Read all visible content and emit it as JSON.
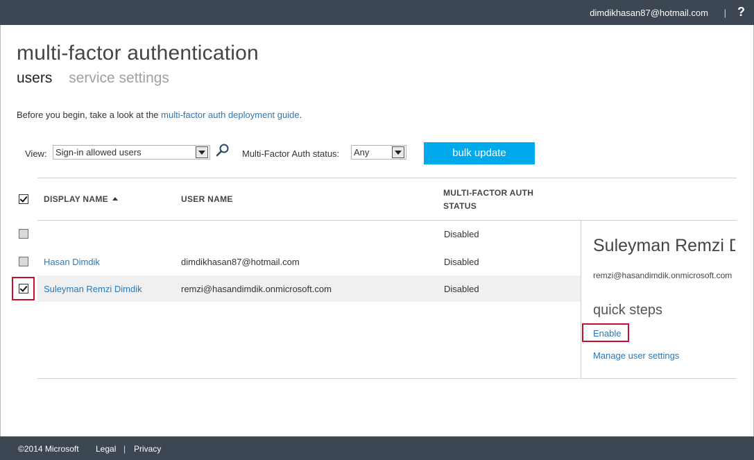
{
  "header": {
    "account": "dimdikhasan87@hotmail.com",
    "separator": "|",
    "help": "?"
  },
  "page": {
    "title": "multi-factor authentication",
    "tabs": [
      {
        "label": "users",
        "active": true
      },
      {
        "label": "service settings",
        "active": false
      }
    ],
    "intro_text": "Before you begin, take a look at the ",
    "intro_link": "multi-factor auth deployment guide",
    "intro_end": "."
  },
  "filters": {
    "view_label": "View:",
    "view_value": "Sign-in allowed users",
    "status_label": "Multi-Factor Auth status:",
    "status_value": "Any",
    "bulk_update": "bulk update"
  },
  "table": {
    "headers": {
      "display_name": "DISPLAY NAME",
      "user_name": "USER NAME",
      "mfa_status_line1": "MULTI-FACTOR AUTH",
      "mfa_status_line2": "STATUS"
    },
    "rows": [
      {
        "display_name": "",
        "user_name": "",
        "status": "Disabled",
        "checked": false
      },
      {
        "display_name": "Hasan Dimdik",
        "user_name": "dimdikhasan87@hotmail.com",
        "status": "Disabled",
        "checked": false
      },
      {
        "display_name": "Suleyman Remzi Dimdik",
        "user_name": "remzi@hasandimdik.onmicrosoft.com",
        "status": "Disabled",
        "checked": true
      }
    ]
  },
  "detail": {
    "name": "Suleyman Remzi Dimdik",
    "email": "remzi@hasandimdik.onmicrosoft.com",
    "quick_steps": "quick steps",
    "enable": "Enable",
    "manage": "Manage user settings"
  },
  "footer": {
    "copyright": "©2014 Microsoft",
    "legal": "Legal",
    "privacy": "Privacy",
    "separator": "|"
  },
  "colors": {
    "topbar": "#3c4753",
    "accent": "#00a9ec",
    "link": "#2b78b6",
    "highlight": "#c8102e"
  }
}
